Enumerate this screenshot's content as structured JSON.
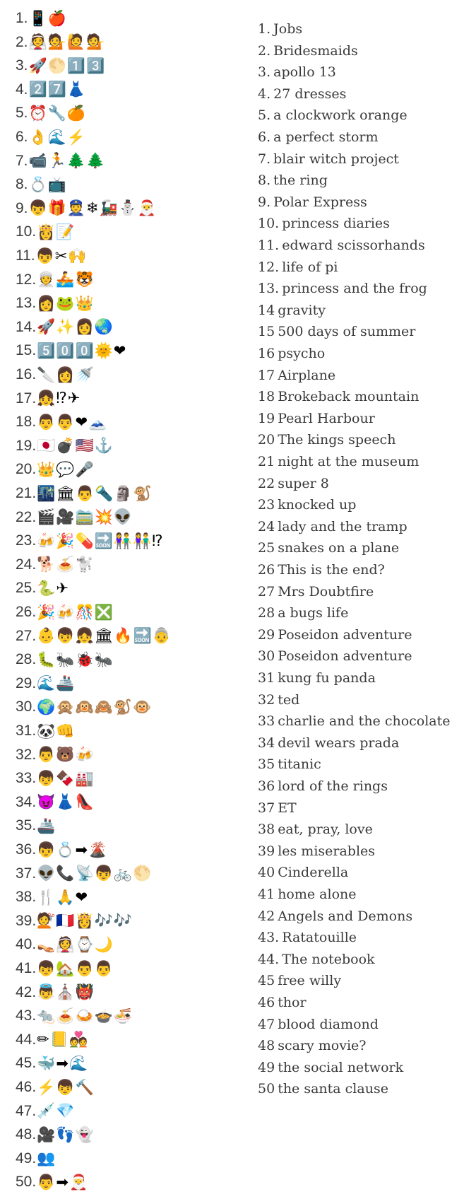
{
  "questions": [
    {
      "num": "1.",
      "emojis": "📱🍎"
    },
    {
      "num": "2.",
      "emojis": "👰💁🙋💁"
    },
    {
      "num": "3.",
      "emojis": "🚀🌕1️⃣3️⃣"
    },
    {
      "num": "4.",
      "emojis": "2️⃣7️⃣👗"
    },
    {
      "num": "5.",
      "emojis": "⏰🔧🍊"
    },
    {
      "num": "6.",
      "emojis": "👌🌊⚡"
    },
    {
      "num": "7.",
      "emojis": "📹🏃🌲🌲"
    },
    {
      "num": "8.",
      "emojis": "💍📺"
    },
    {
      "num": "9.",
      "emojis": "👦🎁👮❄🚂⛄🎅"
    },
    {
      "num": "10.",
      "emojis": "👸📝"
    },
    {
      "num": "11.",
      "emojis": "👦✂🙌"
    },
    {
      "num": "12.",
      "emojis": "👳🚣🐯"
    },
    {
      "num": "13.",
      "emojis": "👩🐸👑"
    },
    {
      "num": "14.",
      "emojis": "🚀✨👩🌏"
    },
    {
      "num": "15.",
      "emojis": "5️⃣0️⃣0️⃣🌞❤"
    },
    {
      "num": "16.",
      "emojis": "🔪👩🚿"
    },
    {
      "num": "17.",
      "emojis": "👧⁉✈"
    },
    {
      "num": "18.",
      "emojis": "👨👨❤🗻"
    },
    {
      "num": "19.",
      "emojis": "🇯🇵💣🇺🇸⚓"
    },
    {
      "num": "20.",
      "emojis": "👑💬🎤"
    },
    {
      "num": "21.",
      "emojis": "🌃🏛👨🔦🗿🐒"
    },
    {
      "num": "22.",
      "emojis": "🎬🎥🚞💥👽"
    },
    {
      "num": "23.",
      "emojis": "🍻🎉💊🔜👫👫⁉"
    },
    {
      "num": "24.",
      "emojis": "🐕🍝🐩"
    },
    {
      "num": "25.",
      "emojis": "🐍✈"
    },
    {
      "num": "26.",
      "emojis": "🎉🍻🎊❎"
    },
    {
      "num": "27.",
      "emojis": "👶👦👧🏛🔥🔜👵"
    },
    {
      "num": "28.",
      "emojis": "🐛🐜🐞🐜"
    },
    {
      "num": "29.",
      "emojis": "🌊🚢"
    },
    {
      "num": "30.",
      "emojis": "🌍🙊🙉🙈🐒🐵"
    },
    {
      "num": "31.",
      "emojis": "🐼👊"
    },
    {
      "num": "32.",
      "emojis": "👨🐻🍻"
    },
    {
      "num": "33.",
      "emojis": "👦🍫🏭"
    },
    {
      "num": "34.",
      "emojis": "😈👗👠"
    },
    {
      "num": "35.",
      "emojis": "🚢"
    },
    {
      "num": "36.",
      "emojis": "👦💍➡🌋"
    },
    {
      "num": "37.",
      "emojis": "👽📞📡👦🚲🌕"
    },
    {
      "num": "38.",
      "emojis": "🍴🙏❤"
    },
    {
      "num": "39.",
      "emojis": "💇🇫🇷👸🎶🎶"
    },
    {
      "num": "40.",
      "emojis": "👡👰⌚🌙"
    },
    {
      "num": "41.",
      "emojis": "👦🏡👨👨"
    },
    {
      "num": "42.",
      "emojis": "👼⛪👹"
    },
    {
      "num": "43.",
      "emojis": "🐀🍝🍛🍲🍜"
    },
    {
      "num": "44.",
      "emojis": "✏📒💑"
    },
    {
      "num": "45.",
      "emojis": "🐳➡🌊"
    },
    {
      "num": "46.",
      "emojis": "⚡👦🔨"
    },
    {
      "num": "47.",
      "emojis": "💉💎"
    },
    {
      "num": "48.",
      "emojis": "🎥👣👻"
    },
    {
      "num": "49.",
      "emojis": "👥"
    },
    {
      "num": "50.",
      "emojis": "👨➡🎅"
    }
  ],
  "answers": [
    {
      "num": "1.",
      "text": "Jobs"
    },
    {
      "num": "2.",
      "text": "Bridesmaids"
    },
    {
      "num": "3.",
      "text": "apollo 13"
    },
    {
      "num": "4.",
      "text": "27 dresses"
    },
    {
      "num": "5.",
      "text": "a clockwork orange"
    },
    {
      "num": "6.",
      "text": "a perfect storm"
    },
    {
      "num": "7.",
      "text": "blair witch project"
    },
    {
      "num": "8.",
      "text": "the ring"
    },
    {
      "num": "9.",
      "text": "Polar Express"
    },
    {
      "num": "10.",
      "text": "princess diaries"
    },
    {
      "num": "11.",
      "text": "edward scissorhands"
    },
    {
      "num": "12.",
      "text": "life of pi"
    },
    {
      "num": "13.",
      "text": "princess and the frog"
    },
    {
      "num": "14",
      "text": "gravity"
    },
    {
      "num": "15",
      "text": "500 days of summer"
    },
    {
      "num": "16",
      "text": "psycho"
    },
    {
      "num": "17",
      "text": "Airplane"
    },
    {
      "num": "18",
      "text": "Brokeback mountain"
    },
    {
      "num": "19",
      "text": "Pearl Harbour"
    },
    {
      "num": "20",
      "text": "The kings speech"
    },
    {
      "num": "21",
      "text": "night at the museum"
    },
    {
      "num": "22",
      "text": "super 8"
    },
    {
      "num": "23",
      "text": "knocked up"
    },
    {
      "num": "24",
      "text": "lady and the tramp"
    },
    {
      "num": "25",
      "text": "snakes on a plane"
    },
    {
      "num": "26",
      "text": "This is the end?"
    },
    {
      "num": "27",
      "text": "Mrs Doubtfire"
    },
    {
      "num": "28",
      "text": "a bugs life"
    },
    {
      "num": "29",
      "text": "Poseidon adventure"
    },
    {
      "num": "30",
      "text": "Poseidon adventure"
    },
    {
      "num": "31",
      "text": "kung fu panda"
    },
    {
      "num": "32",
      "text": "ted"
    },
    {
      "num": "33",
      "text": "charlie and the chocolate"
    },
    {
      "num": "34",
      "text": "devil wears prada"
    },
    {
      "num": "35",
      "text": "titanic"
    },
    {
      "num": "36",
      "text": "lord of the rings"
    },
    {
      "num": "37",
      "text": "ET"
    },
    {
      "num": "38",
      "text": "eat, pray, love"
    },
    {
      "num": "39",
      "text": "les miserables"
    },
    {
      "num": "40",
      "text": "Cinderella"
    },
    {
      "num": "41",
      "text": "home alone"
    },
    {
      "num": "42",
      "text": "Angels and Demons"
    },
    {
      "num": "43.",
      "text": "Ratatouille"
    },
    {
      "num": "44.",
      "text": "The notebook"
    },
    {
      "num": "45",
      "text": "free willy"
    },
    {
      "num": "46",
      "text": "thor"
    },
    {
      "num": "47",
      "text": "blood diamond"
    },
    {
      "num": "48",
      "text": "scary movie?"
    },
    {
      "num": "49",
      "text": "the social network"
    },
    {
      "num": "50",
      "text": "the santa clause"
    }
  ]
}
